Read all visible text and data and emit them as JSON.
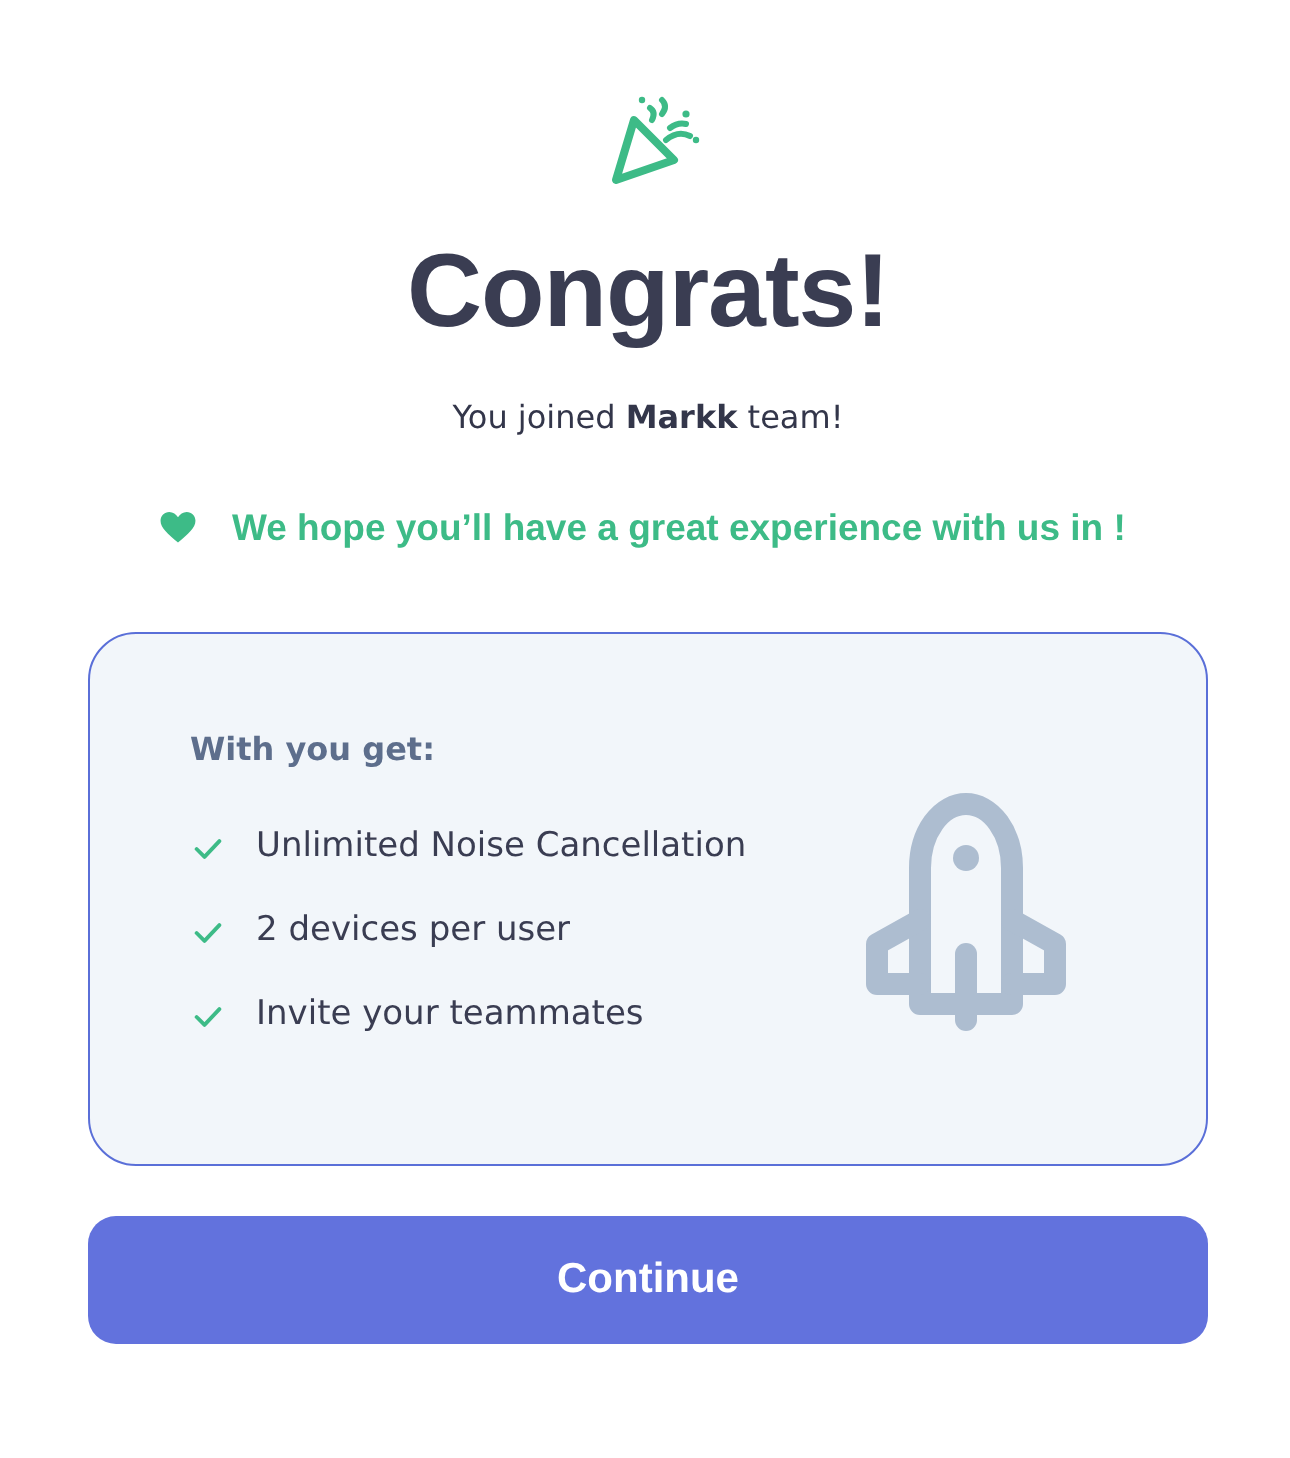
{
  "title": "Congrats!",
  "subtitle": "You joined **Markk** team!",
  "message": "We hope you’ll have a great experience with us in !",
  "card": {
    "heading": "With you get:",
    "features": [
      "Unlimited Noise Cancellation",
      "2 devices per user",
      "Invite your teammates"
    ]
  },
  "button": {
    "label": "Continue"
  }
}
